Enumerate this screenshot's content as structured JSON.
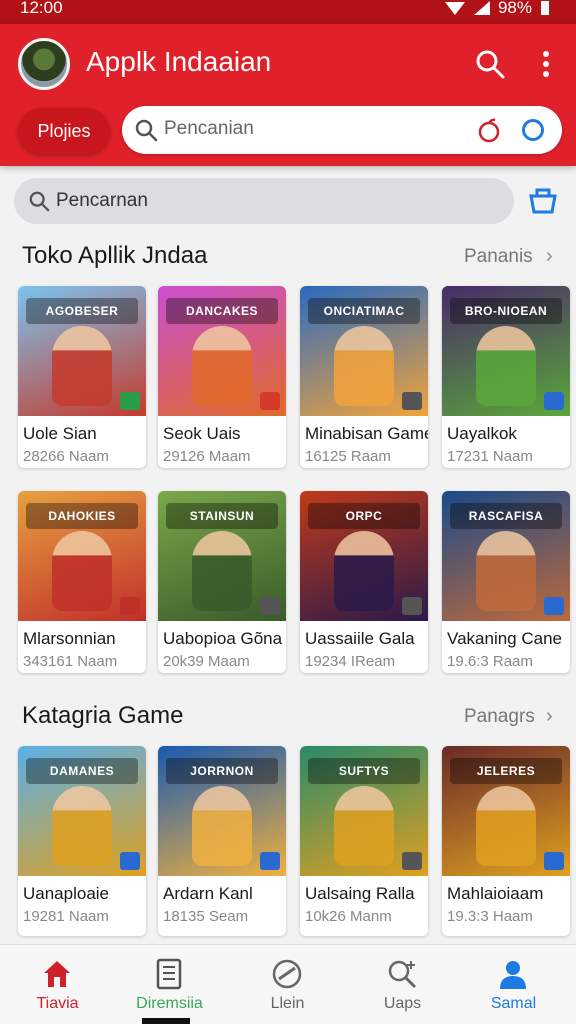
{
  "status": {
    "time": "12:00",
    "battery": "98%"
  },
  "header": {
    "title": "Applk Indaaian",
    "chip_label": "Plojies",
    "search_placeholder": "Pencanian"
  },
  "search_secondary": {
    "placeholder": "Pencarnan"
  },
  "sections": [
    {
      "title": "Toko Apllik Jndaa",
      "link": "Pananis",
      "cards": [
        {
          "name": "Uole Sian",
          "meta": "28266 Naam",
          "banner": "AGOBESER",
          "colors": [
            "#7cc4ef",
            "#c53a2c",
            "#2a9d4a"
          ]
        },
        {
          "name": "Seok Uais",
          "meta": "29126 Maam",
          "banner": "DANCAKES",
          "colors": [
            "#c94fd0",
            "#e06a2a",
            "#d63a2a"
          ]
        },
        {
          "name": "Minabisan Game",
          "meta": "16125 Raam",
          "banner": "ONCIATIMAC",
          "colors": [
            "#2a6ac0",
            "#f2a33a",
            "#555555"
          ]
        },
        {
          "name": "Uayalkok",
          "meta": "17231 Naam",
          "banner": "BRO-NIOEAN",
          "colors": [
            "#4a2a6a",
            "#5aa83a",
            "#2a6ad0"
          ]
        }
      ]
    },
    {
      "title": "",
      "link": "",
      "cards": [
        {
          "name": "Mlarsonnian",
          "meta": "343161 Naam",
          "banner": "DAHOKIES",
          "colors": [
            "#e8a040",
            "#c0302a",
            "#c0302a"
          ]
        },
        {
          "name": "Uabopioa Gõna",
          "meta": "20k39 Maam",
          "banner": "STAINSUN",
          "colors": [
            "#7aa84a",
            "#3a5a2a",
            "#555555"
          ]
        },
        {
          "name": "Uassaiile Gala",
          "meta": "19234 IReam",
          "banner": "ORPC",
          "colors": [
            "#c03a1a",
            "#2a1a4a",
            "#555555"
          ]
        },
        {
          "name": "Vakaning Cane",
          "meta": "19.6:3 Raam",
          "banner": "RASCAFISA",
          "colors": [
            "#1a4a8a",
            "#c06a3a",
            "#2a6ad0"
          ]
        }
      ]
    },
    {
      "title": "Katagria Game",
      "link": "Panagrs",
      "cards": [
        {
          "name": "Uanaploaie",
          "meta": "19281 Naam",
          "banner": "DAMANES",
          "colors": [
            "#5ab0e8",
            "#e0a020",
            "#2a6ad0"
          ]
        },
        {
          "name": "Ardarn Kanl",
          "meta": "18135 Seam",
          "banner": "JORRNON",
          "colors": [
            "#1a5ab0",
            "#f0b040",
            "#2a6ad0"
          ]
        },
        {
          "name": "Ualsaing Ralla",
          "meta": "10k26 Manm",
          "banner": "SUFTYS",
          "colors": [
            "#2a8a6a",
            "#e0a020",
            "#555555"
          ]
        },
        {
          "name": "Mahlaioiaam",
          "meta": "19.3:3 Haam",
          "banner": "JELERES",
          "colors": [
            "#6a2a2a",
            "#e0a020",
            "#2a6ad0"
          ]
        }
      ]
    }
  ],
  "bottom_nav": [
    {
      "label": "Tiavia",
      "icon": "home-icon",
      "color": "#d0202a"
    },
    {
      "label": "Diremsiia",
      "icon": "document-icon",
      "color": "#3aa85a"
    },
    {
      "label": "Llein",
      "icon": "gamepad-icon",
      "color": "#777777"
    },
    {
      "label": "Uaps",
      "icon": "search-plus-icon",
      "color": "#777777"
    },
    {
      "label": "Samal",
      "icon": "person-icon",
      "color": "#1e7be3"
    }
  ]
}
